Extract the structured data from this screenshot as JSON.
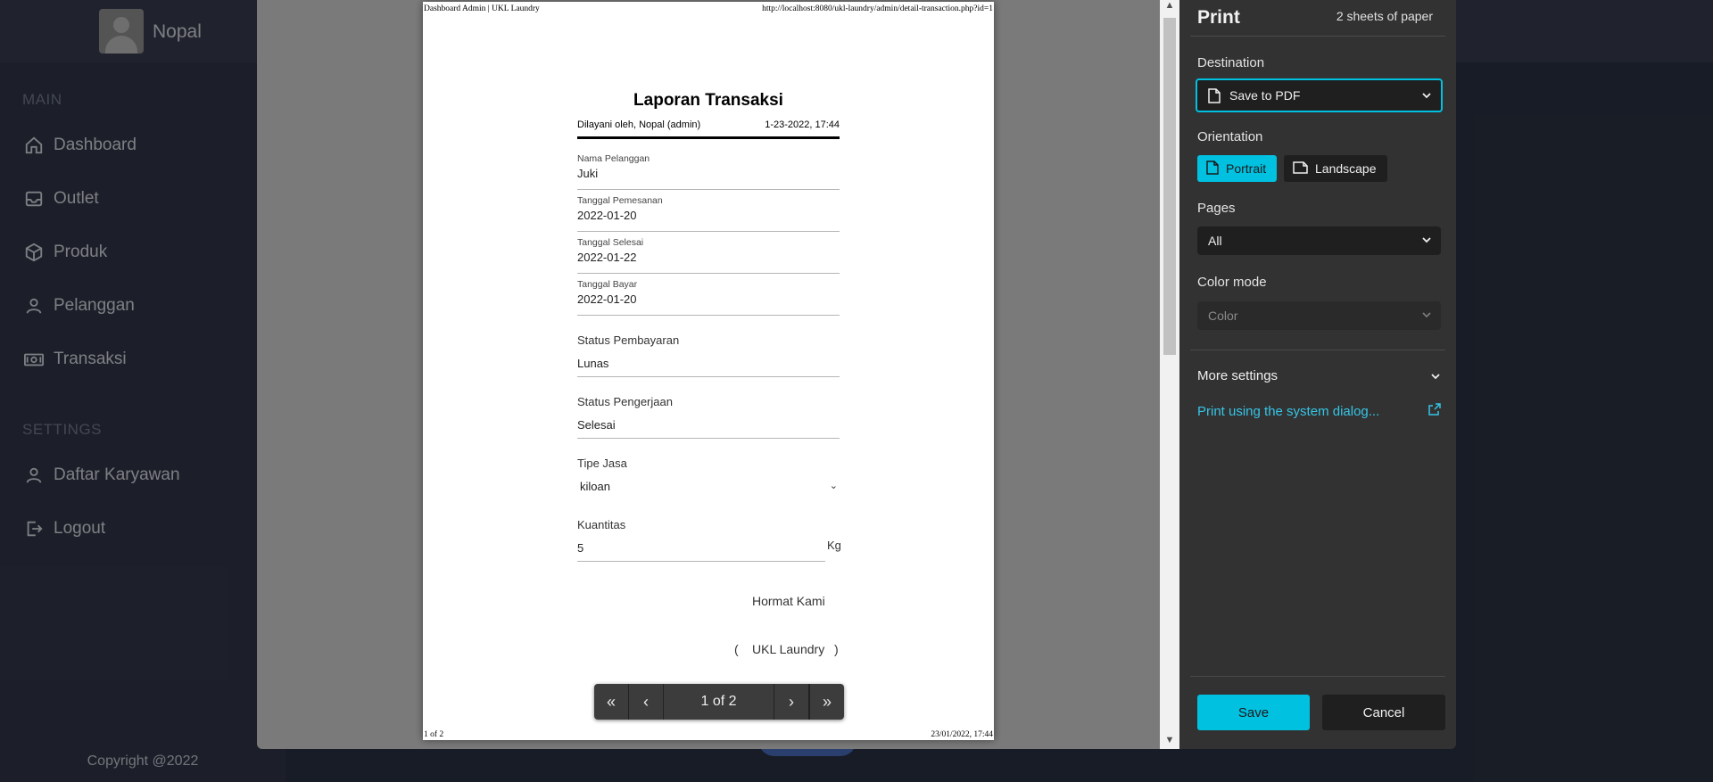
{
  "brand": {
    "name": "Nopal"
  },
  "sidebar": {
    "main_label": "MAIN",
    "settings_label": "SETTINGS",
    "items": [
      {
        "label": "Dashboard",
        "icon": "home-icon"
      },
      {
        "label": "Outlet",
        "icon": "inbox-icon"
      },
      {
        "label": "Produk",
        "icon": "box-icon"
      },
      {
        "label": "Pelanggan",
        "icon": "user-icon"
      },
      {
        "label": "Transaksi",
        "icon": "money-icon"
      }
    ],
    "settings_items": [
      {
        "label": "Daftar Karyawan",
        "icon": "user-icon"
      },
      {
        "label": "Logout",
        "icon": "logout-icon"
      }
    ],
    "copyright": "Copyright @2022"
  },
  "paper": {
    "header_left": "Dashboard Admin | UKL Laundry",
    "header_right": "http://localhost:8080/ukl-laundry/admin/detail-transaction.php?id=1",
    "footer_left": "1 of 2",
    "footer_right": "23/01/2022, 17:44",
    "title": "Laporan Transaksi",
    "served_by": "Dilayani oleh, Nopal (admin)",
    "served_at": "1-23-2022, 17:44",
    "fields": [
      {
        "label": "Nama Pelanggan",
        "value": "Juki"
      },
      {
        "label": "Tanggal Pemesanan",
        "value": "2022-01-20"
      },
      {
        "label": "Tanggal Selesai",
        "value": "2022-01-22"
      },
      {
        "label": "Tanggal Bayar",
        "value": "2022-01-20"
      },
      {
        "label": "Status Pembayaran",
        "value": "Lunas"
      },
      {
        "label": "Status Pengerjaan",
        "value": "Selesai"
      },
      {
        "label": "Tipe Jasa",
        "value": "kiloan"
      },
      {
        "label": "Kuantitas",
        "value": "5"
      }
    ],
    "unit": "Kg",
    "closing": "Hormat Kami",
    "signature": "UKL Laundry",
    "paren_open": "(",
    "paren_close": ")"
  },
  "page_nav": {
    "indicator": "1 of 2"
  },
  "print": {
    "title": "Print",
    "sheets": "2 sheets of paper",
    "destination_label": "Destination",
    "destination_value": "Save to PDF",
    "orientation_label": "Orientation",
    "portrait": "Portrait",
    "landscape": "Landscape",
    "orientation_selected": "Portrait",
    "pages_label": "Pages",
    "pages_value": "All",
    "color_label": "Color mode",
    "color_value": "Color",
    "more_settings": "More settings",
    "system_dialog": "Print using the system dialog...",
    "save": "Save",
    "cancel": "Cancel"
  },
  "colors": {
    "accent": "#00c1e0",
    "sidebar": "#343a4c",
    "dialog": "#323232"
  }
}
